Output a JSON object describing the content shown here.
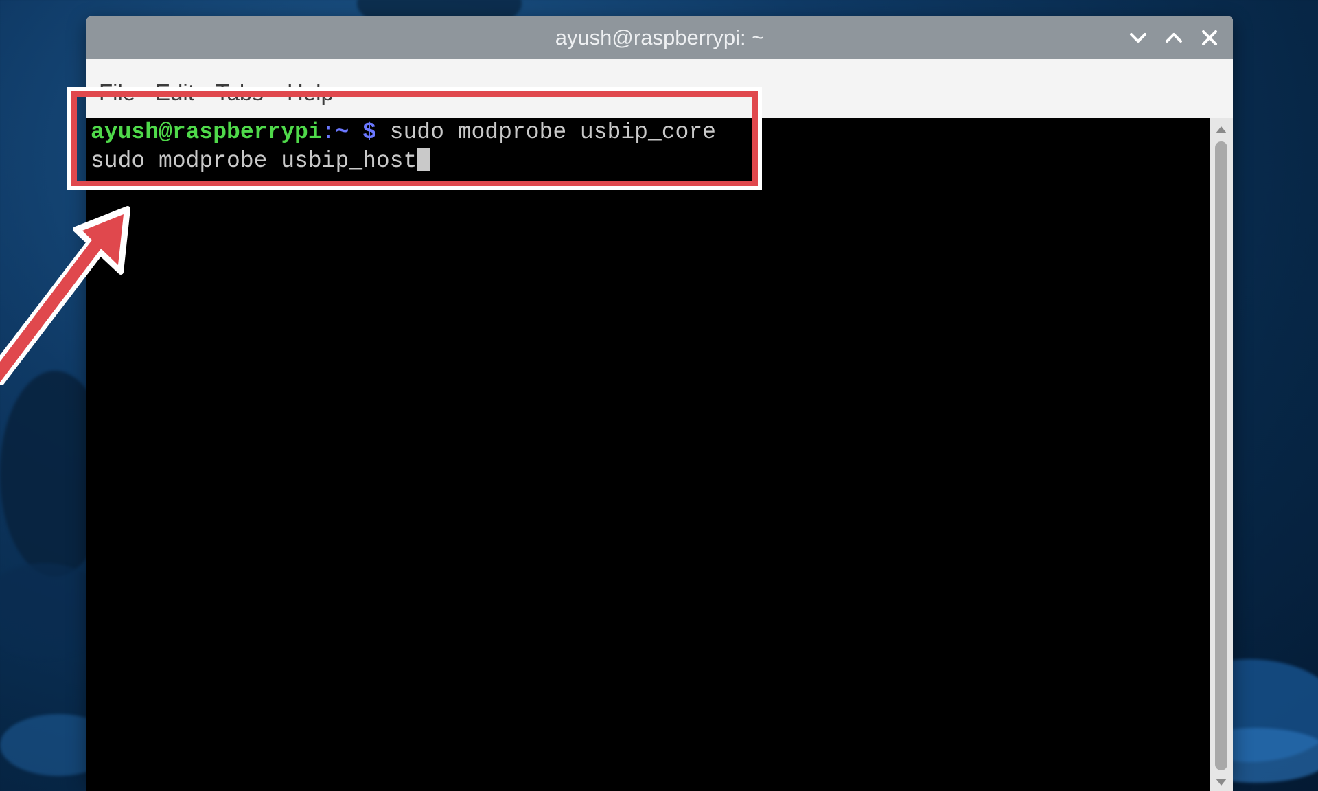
{
  "window": {
    "title": "ayush@raspberrypi: ~"
  },
  "menu": {
    "file": "File",
    "edit": "Edit",
    "tabs": "Tabs",
    "help": "Help"
  },
  "terminal": {
    "prompt_user": "ayush@raspberrypi",
    "prompt_path": ":~",
    "prompt_sign": " $",
    "command_1": " sudo modprobe usbip_core",
    "command_2": "sudo modprobe usbip_host"
  },
  "colors": {
    "prompt_user": "#4fd94a",
    "prompt_path": "#6b78ff",
    "terminal_bg": "#000000",
    "terminal_text": "#c9c9c9",
    "annotation": "#e0484d"
  },
  "icons": {
    "minimize": "chevron-down-icon",
    "maximize": "chevron-up-icon",
    "close": "close-icon"
  }
}
